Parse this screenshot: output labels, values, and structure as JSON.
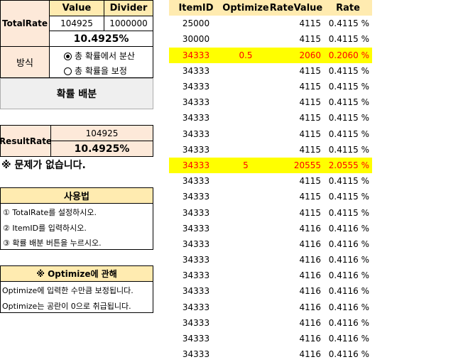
{
  "settings": {
    "total_rate_label": "TotalRate",
    "value_header": "Value",
    "divider_header": "Divider",
    "value": "104925",
    "divider": "1000000",
    "percent": "10.4925%"
  },
  "method": {
    "label": "방식",
    "option_distribute": "총 확률에서 분산",
    "option_correct": "총 확률을 보정",
    "selected": "총 확률에서 분산"
  },
  "distribute_button": "확률 배분",
  "result": {
    "label": "ResultRate",
    "value": "104925",
    "percent": "10.4925%",
    "message": "※ 문제가 없습니다."
  },
  "usage": {
    "title": "사용법",
    "steps": [
      "① TotalRate를 설정하시오.",
      "② ItemID를 입력하시오.",
      "③ 확률 배분 버튼을 누르시오."
    ]
  },
  "optimize_note": {
    "title": "※ Optimize에 관해",
    "lines": [
      "Optimize에 입력한 수만큼 보정됩니다.",
      "Optimize는 공란이 0으로 취급됩니다."
    ]
  },
  "table": {
    "headers": [
      "ItemID",
      "Optimize",
      "RateValue",
      "Rate"
    ],
    "rows": [
      {
        "item": "25000",
        "opt": "",
        "value": "4115",
        "rate": "0.4115 %",
        "highlight": false
      },
      {
        "item": "30000",
        "opt": "",
        "value": "4115",
        "rate": "0.4115 %",
        "highlight": false
      },
      {
        "item": "34333",
        "opt": "0.5",
        "value": "2060",
        "rate": "0.2060 %",
        "highlight": true
      },
      {
        "item": "34333",
        "opt": "",
        "value": "4115",
        "rate": "0.4115 %",
        "highlight": false
      },
      {
        "item": "34333",
        "opt": "",
        "value": "4115",
        "rate": "0.4115 %",
        "highlight": false
      },
      {
        "item": "34333",
        "opt": "",
        "value": "4115",
        "rate": "0.4115 %",
        "highlight": false
      },
      {
        "item": "34333",
        "opt": "",
        "value": "4115",
        "rate": "0.4115 %",
        "highlight": false
      },
      {
        "item": "34333",
        "opt": "",
        "value": "4115",
        "rate": "0.4115 %",
        "highlight": false
      },
      {
        "item": "34333",
        "opt": "",
        "value": "4115",
        "rate": "0.4115 %",
        "highlight": false
      },
      {
        "item": "34333",
        "opt": "5",
        "value": "20555",
        "rate": "2.0555 %",
        "highlight": true
      },
      {
        "item": "34333",
        "opt": "",
        "value": "4115",
        "rate": "0.4115 %",
        "highlight": false
      },
      {
        "item": "34333",
        "opt": "",
        "value": "4115",
        "rate": "0.4115 %",
        "highlight": false
      },
      {
        "item": "34333",
        "opt": "",
        "value": "4115",
        "rate": "0.4115 %",
        "highlight": false
      },
      {
        "item": "34333",
        "opt": "",
        "value": "4116",
        "rate": "0.4116 %",
        "highlight": false
      },
      {
        "item": "34333",
        "opt": "",
        "value": "4116",
        "rate": "0.4116 %",
        "highlight": false
      },
      {
        "item": "34333",
        "opt": "",
        "value": "4116",
        "rate": "0.4116 %",
        "highlight": false
      },
      {
        "item": "34333",
        "opt": "",
        "value": "4116",
        "rate": "0.4116 %",
        "highlight": false
      },
      {
        "item": "34333",
        "opt": "",
        "value": "4116",
        "rate": "0.4116 %",
        "highlight": false
      },
      {
        "item": "34333",
        "opt": "",
        "value": "4116",
        "rate": "0.4116 %",
        "highlight": false
      },
      {
        "item": "34333",
        "opt": "",
        "value": "4116",
        "rate": "0.4116 %",
        "highlight": false
      },
      {
        "item": "34333",
        "opt": "",
        "value": "4116",
        "rate": "0.4116 %",
        "highlight": false
      },
      {
        "item": "34333",
        "opt": "",
        "value": "4116",
        "rate": "0.4116 %",
        "highlight": false
      }
    ]
  },
  "colors": {
    "header_amber": "#ffebb0",
    "label_peach": "#fde9d9",
    "highlight_bg": "#ffff00",
    "highlight_text": "#ff0000"
  }
}
